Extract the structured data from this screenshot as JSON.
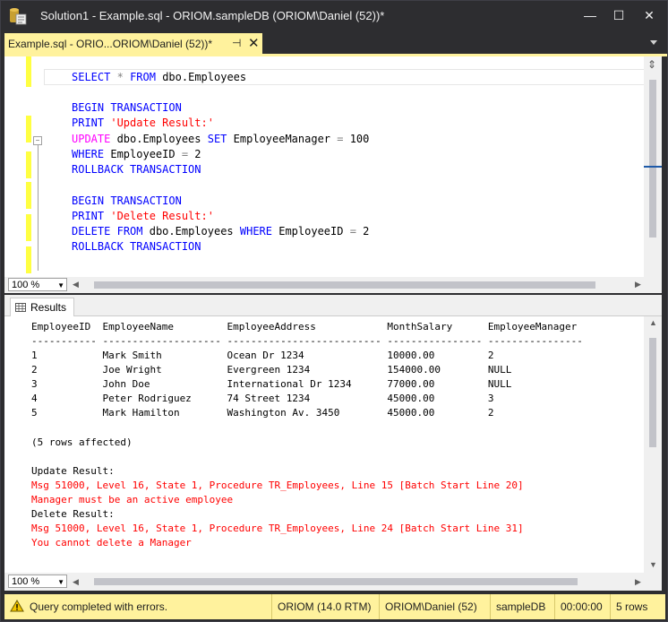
{
  "window": {
    "title": "Solution1 - Example.sql - ORIOM.sampleDB (ORIOM\\Daniel (52))*",
    "minimize_glyph": "—",
    "maximize_glyph": "☐",
    "close_glyph": "✕"
  },
  "tab": {
    "label": "Example.sql - ORIO...ORIOM\\Daniel (52))*",
    "pin_glyph": "⊣",
    "close_glyph": "✕"
  },
  "code": [
    {
      "text": "SELECT * FROM dbo.Employees"
    },
    {
      "text": ""
    },
    {
      "text": "BEGIN TRANSACTION"
    },
    {
      "text": "PRINT 'Update Result:'"
    },
    {
      "text": "UPDATE dbo.Employees SET EmployeeManager = 100"
    },
    {
      "text": "WHERE EmployeeID = 2"
    },
    {
      "text": "ROLLBACK TRANSACTION"
    },
    {
      "text": ""
    },
    {
      "text": "BEGIN TRANSACTION"
    },
    {
      "text": "PRINT 'Delete Result:'"
    },
    {
      "text": "DELETE FROM dbo.Employees WHERE EmployeeID = 2"
    },
    {
      "text": "ROLLBACK TRANSACTION"
    }
  ],
  "editor_zoom": "100 %",
  "results": {
    "tab_label": "Results",
    "header": "EmployeeID  EmployeeName         EmployeeAddress            MonthSalary      EmployeeManager",
    "separator": "----------- -------------------- -------------------------- ---------------- ----------------",
    "rows": [
      "1           Mark Smith           Ocean Dr 1234              10000.00         2",
      "2           Joe Wright           Evergreen 1234             154000.00        NULL",
      "3           John Doe             International Dr 1234      77000.00         NULL",
      "4           Peter Rodriguez      74 Street 1234             45000.00         3",
      "5           Mark Hamilton        Washington Av. 3450        45000.00         2"
    ],
    "rows_affected": "(5 rows affected)",
    "messages": [
      {
        "text": "Update Result:",
        "color": "black"
      },
      {
        "text": "Msg 51000, Level 16, State 1, Procedure TR_Employees, Line 15 [Batch Start Line 20]",
        "color": "red"
      },
      {
        "text": "Manager must be an active employee",
        "color": "red"
      },
      {
        "text": "Delete Result:",
        "color": "black"
      },
      {
        "text": "Msg 51000, Level 16, State 1, Procedure TR_Employees, Line 24 [Batch Start Line 31]",
        "color": "red"
      },
      {
        "text": "You cannot delete a Manager",
        "color": "red"
      }
    ],
    "zoom": "100 %"
  },
  "status": {
    "message": "Query completed with errors.",
    "server": "ORIOM (14.0 RTM)",
    "user": "ORIOM\\Daniel (52)",
    "database": "sampleDB",
    "elapsed": "00:00:00",
    "rows": "5 rows"
  },
  "colors": {
    "accent_yellow": "#fff29d",
    "keyword_blue": "#0000ff",
    "function_magenta": "#ff00ff",
    "string_red": "#ff0000",
    "error_red": "#ff0000"
  }
}
